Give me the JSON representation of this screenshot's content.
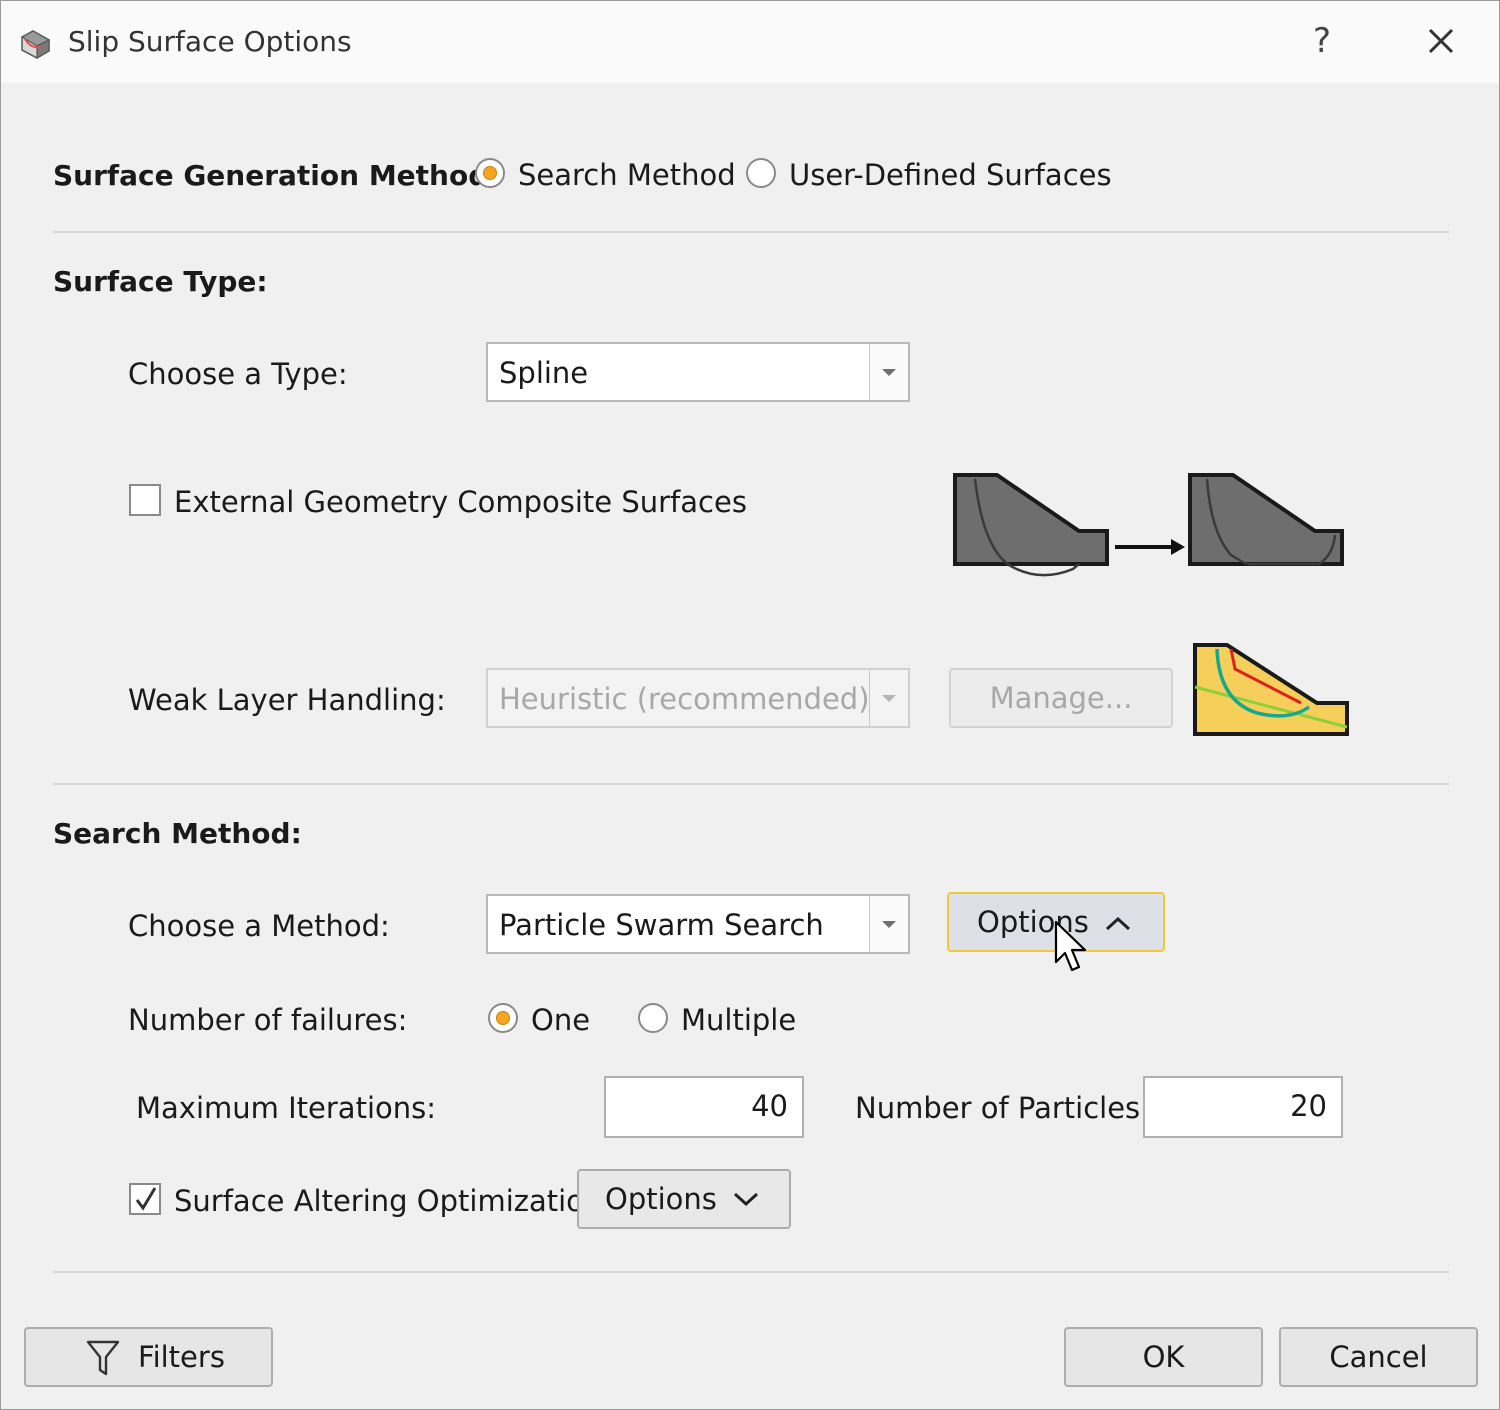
{
  "window": {
    "title": "Slip Surface Options",
    "help_glyph": "?"
  },
  "surface_generation": {
    "label": "Surface Generation Method:",
    "options": [
      "Search Method",
      "User-Defined Surfaces"
    ],
    "selected": "Search Method"
  },
  "surface_type": {
    "heading": "Surface Type:",
    "choose_label": "Choose a Type:",
    "type_value": "Spline",
    "external_geometry_label": "External Geometry Composite Surfaces",
    "external_geometry_checked": false,
    "weak_layer_label": "Weak Layer Handling:",
    "weak_layer_value": "Heuristic (recommended)",
    "manage_label": "Manage..."
  },
  "search_method": {
    "heading": "Search Method:",
    "choose_label": "Choose a Method:",
    "method_value": "Particle Swarm Search",
    "options_label": "Options",
    "failures_label": "Number of failures:",
    "failure_options": [
      "One",
      "Multiple"
    ],
    "failures_selected": "One",
    "max_iterations_label": "Maximum Iterations:",
    "max_iterations_value": "40",
    "particles_label": "Number of Particles:",
    "particles_value": "20",
    "surface_altering_label": "Surface Altering Optimization",
    "surface_altering_checked": true,
    "surface_altering_options_label": "Options"
  },
  "footer": {
    "filters_label": "Filters",
    "ok_label": "OK",
    "cancel_label": "Cancel"
  },
  "icons": {
    "app": "slope-app-icon",
    "close": "close-icon",
    "filter": "funnel-icon",
    "collapse": "chevron-up-icon",
    "expand": "chevron-down-icon",
    "cursor": "mouse-pointer-icon"
  },
  "colors": {
    "radio_selected": "#f4a623",
    "hover_border": "#f0c93a",
    "slope_fill": "#6e6e6e",
    "weak_layer_fill": "#f5cf5a",
    "weak_layer_line": "#8fcf3a",
    "failure_red": "#e02020",
    "failure_teal": "#15a88e"
  }
}
